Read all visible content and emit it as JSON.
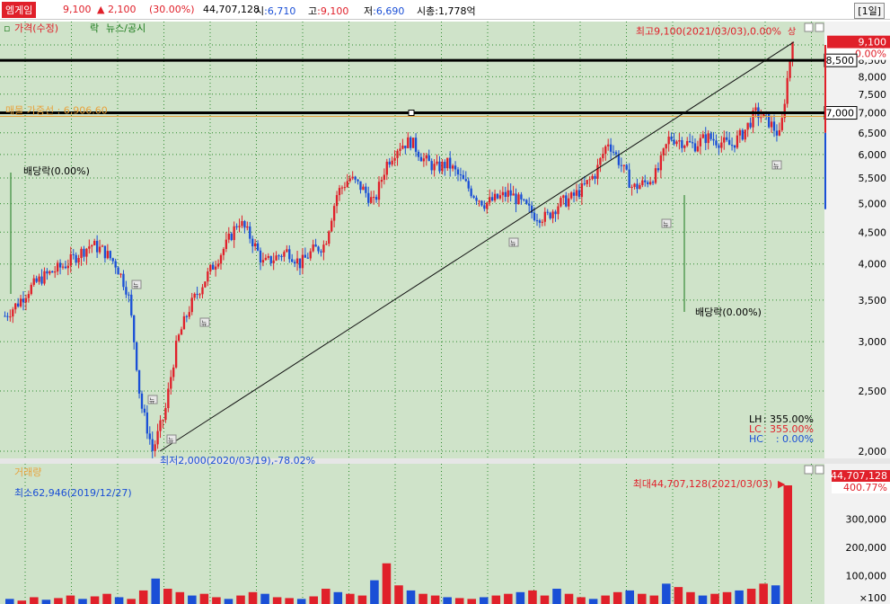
{
  "header": {
    "stock_name": "엠게임",
    "price": "9,100",
    "change": "2,100",
    "change_pct": "(30.00%)",
    "volume": "44,707,128",
    "open_label": "시",
    "open_value": ":6,710",
    "high_label": "고",
    "high_value": ":9,100",
    "low_label": "저",
    "low_value": ":6,690",
    "mcap_label": "시총",
    "mcap_value": ":1,778억",
    "period": "[1일]",
    "up_arrow_icon": "up-arrow-icon"
  },
  "price_panel": {
    "legend": [
      "가격(수정)",
      "락",
      "뉴스/공시"
    ],
    "hline_label": "매물 가중선 : 6,906.60",
    "max_annotation": "최고9,100(2021/03/03),0.00%",
    "min_annotation": "최저2,000(2020/03/19),-78.02%",
    "ex_dividend_1": "배당락(0.00%)",
    "ex_dividend_2": "배당락(0.00%)",
    "current_price_tag": "9,100",
    "current_pct_tag": "0.00%",
    "level_tag_1": "8,500",
    "level_tag_2": "7,000",
    "stats": [
      {
        "label": "LH",
        "value": "355.00%",
        "color": "#000000"
      },
      {
        "label": "LC",
        "value": "355.00%",
        "color": "#e0202a"
      },
      {
        "label": "HC",
        "value": "0.00%",
        "color": "#1a4fd6"
      }
    ],
    "news_icon": "뉴",
    "upper_limit_mark": "상"
  },
  "volume_panel": {
    "legend": "거래량",
    "min_annotation": "최소62,946(2019/12/27)",
    "max_annotation": "최대44,707,128(2021/03/03)",
    "vol_tag": "44,707,128",
    "vol_pct_tag": "400.77%",
    "unit": "×100"
  },
  "colors": {
    "bg": "#cfe3c9",
    "up": "#e0202a",
    "down": "#1a4fd6",
    "grid": "#2e8b2e",
    "axis_bg": "#f2f2f2",
    "trend": "#111111"
  },
  "chart_data": [
    {
      "type": "candlestick",
      "title": "",
      "scale": "log",
      "ylim": [
        1900,
        9400
      ],
      "y_ticks": [
        2000,
        2500,
        3000,
        3500,
        4000,
        4500,
        5000,
        5500,
        6000,
        6500,
        7000,
        7500,
        8000,
        8500,
        9000
      ],
      "key_points": [
        {
          "label": "최저",
          "date": "2020/03/19",
          "value": 2000
        },
        {
          "label": "최고",
          "date": "2021/03/03",
          "value": 9100
        },
        {
          "label": "현재가",
          "value": 9100
        },
        {
          "label": "hline",
          "value": 8500
        },
        {
          "label": "hline",
          "value": 7000
        },
        {
          "label": "매물 가중선",
          "value": 6906.6
        }
      ],
      "trendline": [
        [
          2000,
          9100
        ]
      ],
      "close_path": [
        3300,
        3450,
        3650,
        3800,
        3900,
        4000,
        4150,
        4300,
        4200,
        4000,
        3600,
        2400,
        2000,
        2300,
        3000,
        3400,
        3700,
        4000,
        4300,
        4700,
        4400,
        4000,
        4100,
        4200,
        4000,
        4200,
        4300,
        5200,
        5500,
        5300,
        5000,
        5800,
        6200,
        6300,
        5900,
        5700,
        5800,
        5500,
        5200,
        5000,
        5100,
        5200,
        5000,
        4800,
        4750,
        5000,
        5100,
        5300,
        5600,
        6300,
        5800,
        5300,
        5400,
        5600,
        6400,
        6300,
        6200,
        6400,
        6300,
        6200,
        6500,
        7000,
        6800,
        6400,
        9100
      ]
    },
    {
      "type": "bar",
      "title": "",
      "unit": "×100",
      "y_ticks": [
        100000,
        200000,
        300000
      ],
      "ylim": [
        0,
        420000
      ],
      "max": {
        "date": "2021/03/03",
        "value": 44707128
      },
      "min": {
        "date": "2019/12/27",
        "value": 62946
      },
      "values": [
        300,
        200,
        400,
        250,
        350,
        500,
        300,
        450,
        600,
        400,
        300,
        800,
        1500,
        900,
        700,
        500,
        600,
        400,
        300,
        500,
        700,
        600,
        400,
        350,
        300,
        450,
        900,
        700,
        600,
        500,
        1400,
        2400,
        1100,
        800,
        600,
        500,
        400,
        350,
        300,
        400,
        500,
        600,
        700,
        800,
        500,
        900,
        600,
        400,
        300,
        500,
        700,
        800,
        600,
        500,
        1200,
        1000,
        700,
        500,
        600,
        700,
        800,
        900,
        1200,
        1100,
        400000
      ]
    }
  ]
}
